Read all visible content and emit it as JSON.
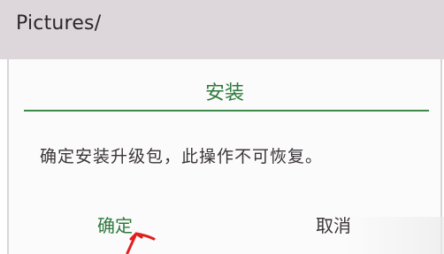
{
  "header": {
    "path": "Pictures/"
  },
  "dialog": {
    "title": "安装",
    "message": "确定安装升级包，此操作不可恢复。",
    "confirm_label": "确定",
    "cancel_label": "取消"
  },
  "colors": {
    "accent": "#2f7a3e",
    "header_bg": "#ddd7dc",
    "annotation_arrow": "#e02020"
  }
}
